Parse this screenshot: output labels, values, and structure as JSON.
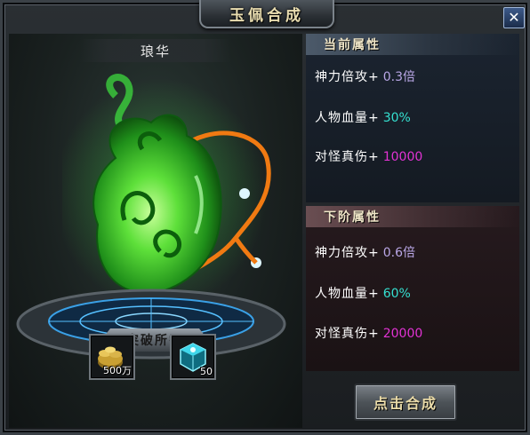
{
  "window": {
    "title": "玉佩合成",
    "close_icon": "close-icon"
  },
  "item": {
    "name": "琅华",
    "art": "jade-pendant-icon"
  },
  "requirements": {
    "label": "突破所需",
    "materials": [
      {
        "icon": "gold-coins-icon",
        "count": "500万"
      },
      {
        "icon": "cyan-gem-box-icon",
        "count": "50"
      }
    ]
  },
  "current_attributes": {
    "header": "当前属性",
    "stats": [
      {
        "label": "神力倍攻+",
        "value": "0.3倍"
      },
      {
        "label": "人物血量+",
        "value": "30%"
      },
      {
        "label": "对怪真伤+",
        "value": "10000"
      }
    ]
  },
  "next_attributes": {
    "header": "下阶属性",
    "stats": [
      {
        "label": "神力倍攻+",
        "value": "0.6倍"
      },
      {
        "label": "人物血量+",
        "value": "60%"
      },
      {
        "label": "对怪真伤+",
        "value": "20000"
      }
    ]
  },
  "actions": {
    "compose_label": "点击合成"
  },
  "colors": {
    "value_multiplier": "#b9a7e6",
    "value_percent": "#35e0d0",
    "value_damage": "#e233d4"
  }
}
